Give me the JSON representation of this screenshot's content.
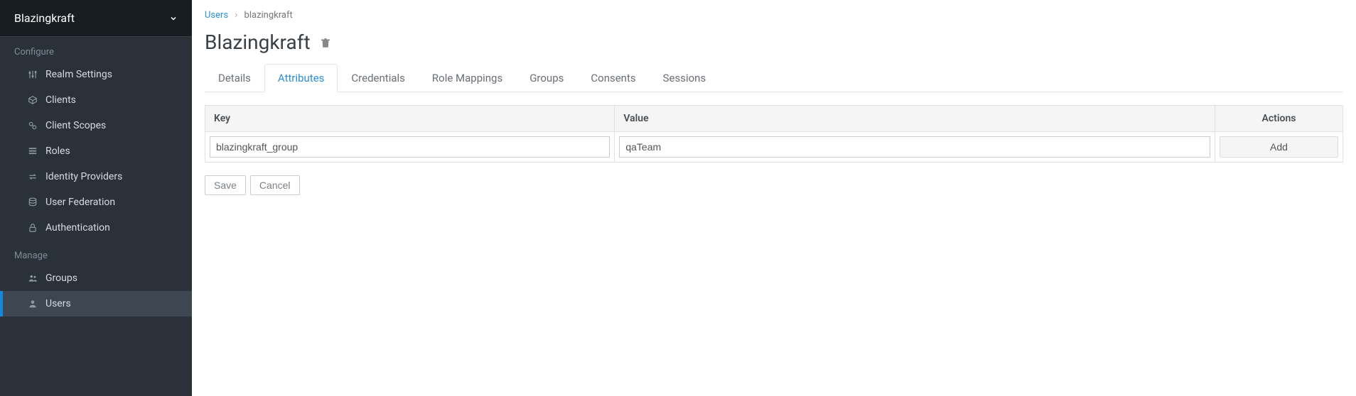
{
  "realm": {
    "name": "Blazingkraft"
  },
  "sidebar": {
    "sections": [
      {
        "label": "Configure",
        "items": [
          {
            "icon": "sliders",
            "label": "Realm Settings"
          },
          {
            "icon": "cube",
            "label": "Clients"
          },
          {
            "icon": "scopes",
            "label": "Client Scopes"
          },
          {
            "icon": "list",
            "label": "Roles"
          },
          {
            "icon": "exchange",
            "label": "Identity Providers"
          },
          {
            "icon": "database",
            "label": "User Federation"
          },
          {
            "icon": "lock",
            "label": "Authentication"
          }
        ]
      },
      {
        "label": "Manage",
        "items": [
          {
            "icon": "users",
            "label": "Groups"
          },
          {
            "icon": "user",
            "label": "Users",
            "active": true
          }
        ]
      }
    ]
  },
  "breadcrumb": {
    "link": "Users",
    "current": "blazingkraft"
  },
  "page": {
    "title": "Blazingkraft"
  },
  "tabs": [
    {
      "label": "Details"
    },
    {
      "label": "Attributes",
      "active": true
    },
    {
      "label": "Credentials"
    },
    {
      "label": "Role Mappings"
    },
    {
      "label": "Groups"
    },
    {
      "label": "Consents"
    },
    {
      "label": "Sessions"
    }
  ],
  "table": {
    "headers": {
      "key": "Key",
      "value": "Value",
      "actions": "Actions"
    },
    "row": {
      "key": "blazingkraft_group",
      "value": "qaTeam",
      "action": "Add"
    }
  },
  "buttons": {
    "save": "Save",
    "cancel": "Cancel"
  }
}
